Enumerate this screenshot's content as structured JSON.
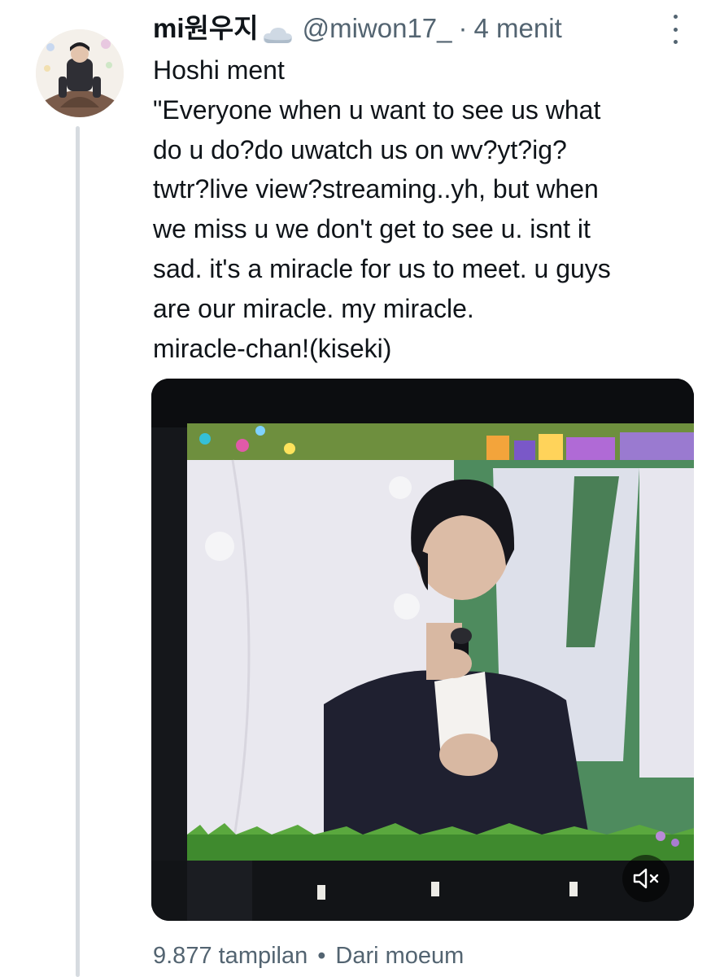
{
  "tweet": {
    "display_name": "mi원우지",
    "name_emoji_icon": "cloud-icon",
    "handle": "@miwon17_",
    "separator": "·",
    "time": "4 menit",
    "text_lines": [
      "Hoshi ment",
      "\"Everyone when u want to see us what",
      "do u do?do uwatch us on wv?yt?ig?",
      "twtr?live view?streaming..yh, but when",
      "we miss u we don't get to see u. isnt it",
      "sad. it's a miracle for us to meet. u guys",
      "are our miracle. my miracle.",
      "miracle-chan!(kiseki)"
    ],
    "media": {
      "type": "video",
      "muted_icon": "speaker-muted-icon"
    },
    "footer": {
      "views": "9.877 tampilan",
      "separator": "•",
      "source": "Dari moeum"
    }
  },
  "colors": {
    "text_primary": "#0f1419",
    "text_secondary": "#536471",
    "thread_line": "#d6dbe0"
  }
}
